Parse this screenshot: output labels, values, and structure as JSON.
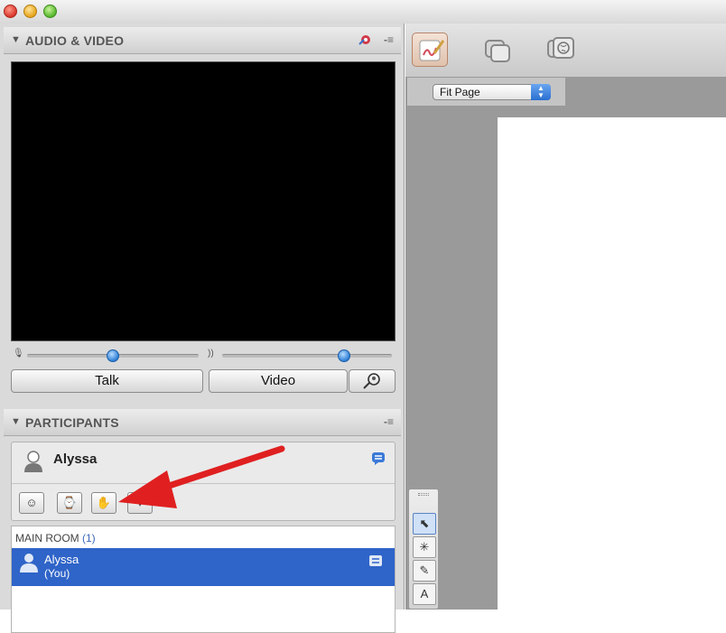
{
  "window": {
    "traffic_lights": [
      "close",
      "minimize",
      "maximize"
    ]
  },
  "audio_video": {
    "title": "AUDIO & VIDEO",
    "talk_label": "Talk",
    "video_label": "Video",
    "mic_volume": 0.5,
    "speaker_volume": 0.72
  },
  "participants": {
    "title": "PARTICIPANTS",
    "me_name": "Alyssa",
    "tools": [
      "emoticon",
      "status",
      "raise-hand",
      "more"
    ]
  },
  "main_room": {
    "label": "MAIN ROOM",
    "count": "(1)",
    "rows": [
      {
        "name": "Alyssa",
        "sub": "(You)"
      }
    ]
  },
  "whiteboard": {
    "zoom_value": "Fit Page",
    "draw_tools": [
      "select",
      "pointer",
      "pencil",
      "text"
    ]
  },
  "colors": {
    "selection": "#2f64c8",
    "annotation_arrow": "#e02020",
    "slider_knob": "#2e7fd6"
  }
}
